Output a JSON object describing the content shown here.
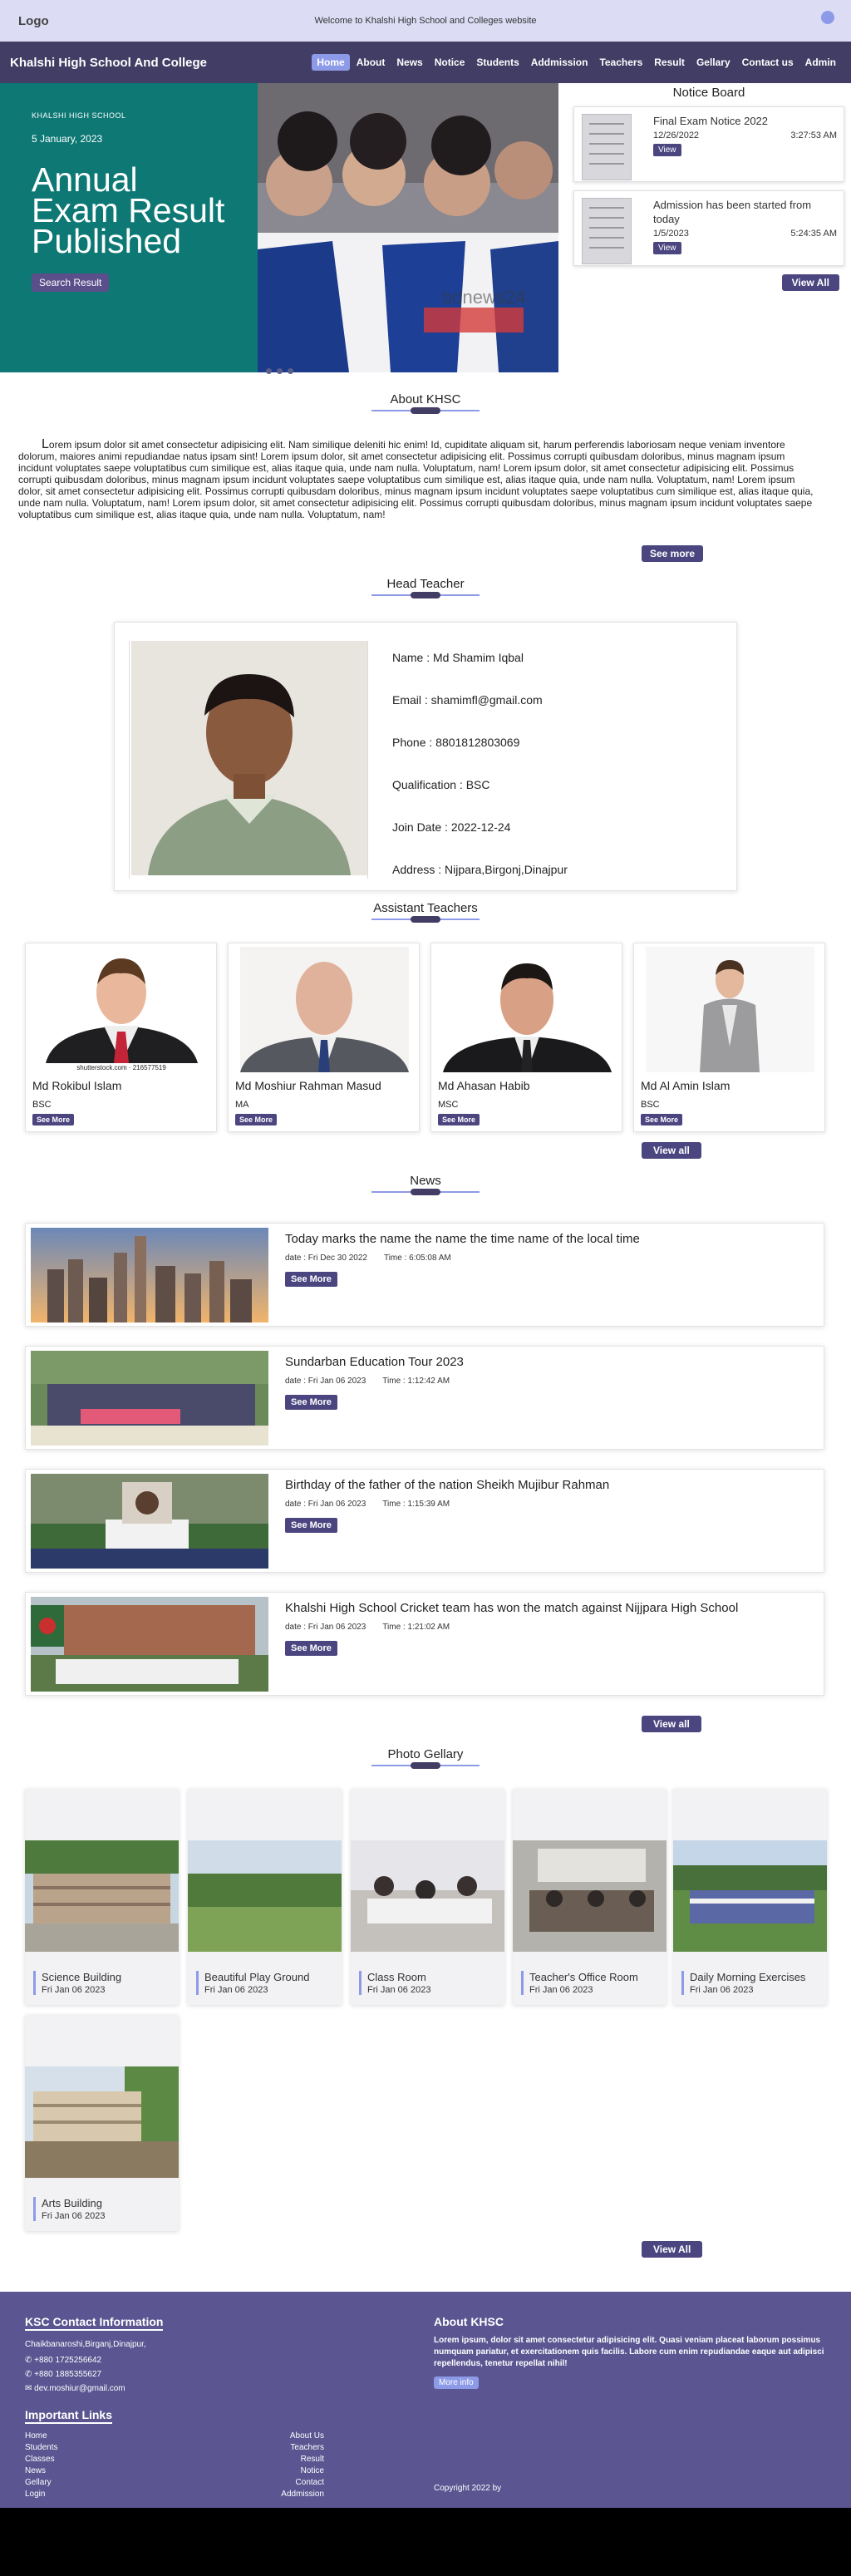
{
  "topbar": {
    "logo": "Logo",
    "welcome": "Welcome to Khalshi High School and Colleges website"
  },
  "navbar": {
    "brand": "Khalshi High School And College",
    "items": [
      "Home",
      "About",
      "News",
      "Notice",
      "Students",
      "Addmission",
      "Teachers",
      "Result",
      "Gellary",
      "Contact us",
      "Admin"
    ]
  },
  "hero": {
    "school": "KHALSHI HIGH SCHOOL",
    "date": "5 January, 2023",
    "heading": "Annual Exam Result Published",
    "button": "Search Result",
    "watermark": "bdnews24"
  },
  "notice_board": {
    "title": "Notice Board",
    "items": [
      {
        "title": "Final Exam Notice 2022",
        "date": "12/26/2022",
        "time": "3:27:53 AM",
        "button": "View"
      },
      {
        "title": "Admission has been started from today",
        "date": "1/5/2023",
        "time": "5:24:35 AM",
        "button": "View"
      }
    ],
    "view_all": "View All"
  },
  "about": {
    "title": "About KHSC",
    "text": "Lorem ipsum dolor sit amet consectetur adipisicing elit. Nam similique deleniti hic enim! Id, cupiditate aliquam sit, harum perferendis laboriosam neque veniam inventore dolorum, maiores animi repudiandae natus ipsam sint! Lorem ipsum dolor, sit amet consectetur adipisicing elit. Possimus corrupti quibusdam doloribus, minus magnam ipsum incidunt voluptates saepe voluptatibus cum similique est, alias itaque quia, unde nam nulla. Voluptatum, nam! Lorem ipsum dolor, sit amet consectetur adipisicing elit. Possimus corrupti quibusdam doloribus, minus magnam ipsum incidunt voluptates saepe voluptatibus cum similique est, alias itaque quia, unde nam nulla. Voluptatum, nam! Lorem ipsum dolor, sit amet consectetur adipisicing elit. Possimus corrupti quibusdam doloribus, minus magnam ipsum incidunt voluptates saepe voluptatibus cum similique est, alias itaque quia, unde nam nulla. Voluptatum, nam! Lorem ipsum dolor, sit amet consectetur adipisicing elit. Possimus corrupti quibusdam doloribus, minus magnam ipsum incidunt voluptates saepe voluptatibus cum similique est, alias itaque quia, unde nam nulla. Voluptatum, nam!",
    "button": "See more"
  },
  "head_teacher": {
    "title": "Head Teacher",
    "name": "Name : Md Shamim Iqbal",
    "email": "Email : shamimfl@gmail.com",
    "phone": "Phone : 8801812803069",
    "qualification": "Qualification : BSC",
    "join_date": "Join Date :  2022-12-24",
    "address": "Address : Nijpara,Birgonj,Dinajpur"
  },
  "assistant_teachers": {
    "title": "Assistant Teachers",
    "items": [
      {
        "name": "Md Rokibul Islam",
        "degree": "BSC",
        "button": "See More",
        "caption": "shutterstock.com · 216577519"
      },
      {
        "name": "Md Moshiur Rahman Masud",
        "degree": "MA",
        "button": "See More"
      },
      {
        "name": "Md Ahasan Habib",
        "degree": "MSC",
        "button": "See More"
      },
      {
        "name": "Md Al Amin Islam",
        "degree": "BSC",
        "button": "See More"
      }
    ],
    "view_all": "View all"
  },
  "news": {
    "title": "News",
    "items": [
      {
        "title": "Today marks the name the name the time name of the local time",
        "date": "date : Fri Dec 30 2022",
        "time": "Time : 6:05:08 AM",
        "button": "See More"
      },
      {
        "title": "Sundarban Education Tour 2023",
        "date": "date : Fri Jan 06 2023",
        "time": "Time : 1:12:42 AM",
        "button": "See More"
      },
      {
        "title": "Birthday of the father of the nation Sheikh Mujibur Rahman",
        "date": "date : Fri Jan 06 2023",
        "time": "Time : 1:15:39 AM",
        "button": "See More"
      },
      {
        "title": "Khalshi High School Cricket team has won the match against Nijjpara High School",
        "date": "date : Fri Jan 06 2023",
        "time": "Time : 1:21:02 AM",
        "button": "See More"
      }
    ],
    "view_all": "View all"
  },
  "gallery": {
    "title": "Photo Gellary",
    "items": [
      {
        "title": "Science Building",
        "date": "Fri Jan 06 2023"
      },
      {
        "title": "Beautiful Play Ground",
        "date": "Fri Jan 06 2023"
      },
      {
        "title": "Class Room",
        "date": "Fri Jan 06 2023"
      },
      {
        "title": "Teacher's Office Room",
        "date": "Fri Jan 06 2023"
      },
      {
        "title": "Daily Morning Exercises",
        "date": "Fri Jan 06 2023"
      },
      {
        "title": "Arts Building",
        "date": "Fri Jan 06 2023"
      }
    ],
    "view_all": "View All"
  },
  "footer": {
    "contact_title": "KSC Contact Information",
    "address": "Chaikbanaroshi,Birganj,Dinajpur,",
    "phone1": "+880 1725256642",
    "phone2": "+880 1885355627",
    "email": "dev.moshiur@gmail.com",
    "links_title": "Important Links",
    "links_left": [
      "Home",
      "Students",
      "Classes",
      "News",
      "Gellary",
      "Login"
    ],
    "links_right": [
      "About Us",
      "Teachers",
      "Result",
      "Notice",
      "Contact",
      "Addmission"
    ],
    "about_title": "About KHSC",
    "about_text": "Lorem ipsum, dolor sit amet consectetur adipisicing elit. Quasi veniam placeat laborum possimus numquam pariatur, et exercitationem quis facilis. Labore cum enim repudiandae eaque aut adipisci repellendus, tenetur repellat nihil!",
    "more_info": "More info",
    "copyright": "Copyright 2022 by"
  }
}
